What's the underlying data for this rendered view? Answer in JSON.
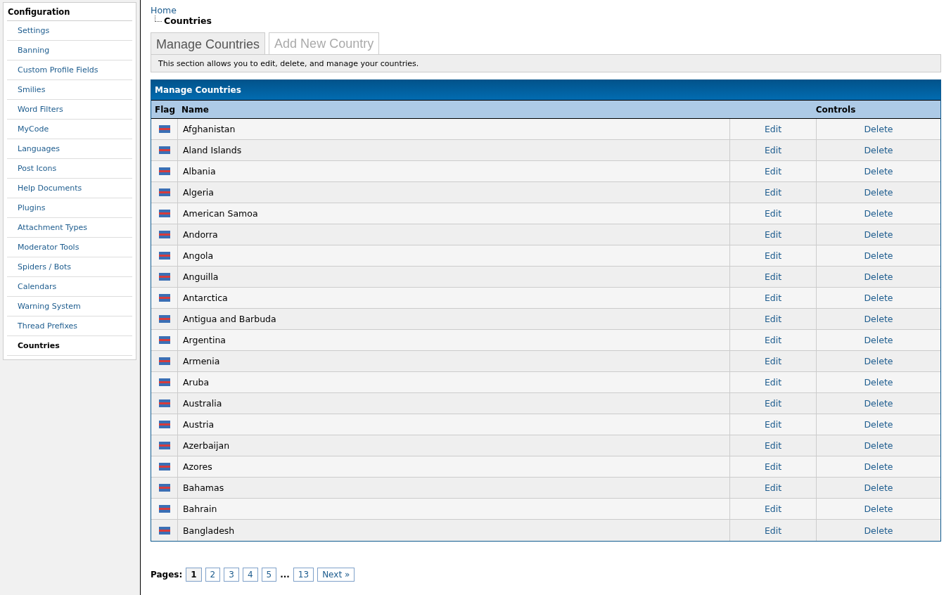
{
  "sidebar": {
    "title": "Configuration",
    "items": [
      {
        "label": "Settings",
        "selected": false
      },
      {
        "label": "Banning",
        "selected": false
      },
      {
        "label": "Custom Profile Fields",
        "selected": false
      },
      {
        "label": "Smilies",
        "selected": false
      },
      {
        "label": "Word Filters",
        "selected": false
      },
      {
        "label": "MyCode",
        "selected": false
      },
      {
        "label": "Languages",
        "selected": false
      },
      {
        "label": "Post Icons",
        "selected": false
      },
      {
        "label": "Help Documents",
        "selected": false
      },
      {
        "label": "Plugins",
        "selected": false
      },
      {
        "label": "Attachment Types",
        "selected": false
      },
      {
        "label": "Moderator Tools",
        "selected": false
      },
      {
        "label": "Spiders / Bots",
        "selected": false
      },
      {
        "label": "Calendars",
        "selected": false
      },
      {
        "label": "Warning System",
        "selected": false
      },
      {
        "label": "Thread Prefixes",
        "selected": false
      },
      {
        "label": "Countries",
        "selected": true
      }
    ]
  },
  "breadcrumb": {
    "home": "Home",
    "current": "Countries"
  },
  "tabs": [
    {
      "label": "Manage Countries",
      "selected": true
    },
    {
      "label": "Add New Country",
      "selected": false
    }
  ],
  "description": "This section allows you to edit, delete, and manage your countries.",
  "table": {
    "title": "Manage Countries",
    "columns": [
      "Flag",
      "Name",
      "Controls"
    ],
    "rows": [
      {
        "name": "Afghanistan",
        "edit": "Edit",
        "delete": "Delete"
      },
      {
        "name": "Aland Islands",
        "edit": "Edit",
        "delete": "Delete"
      },
      {
        "name": "Albania",
        "edit": "Edit",
        "delete": "Delete"
      },
      {
        "name": "Algeria",
        "edit": "Edit",
        "delete": "Delete"
      },
      {
        "name": "American Samoa",
        "edit": "Edit",
        "delete": "Delete"
      },
      {
        "name": "Andorra",
        "edit": "Edit",
        "delete": "Delete"
      },
      {
        "name": "Angola",
        "edit": "Edit",
        "delete": "Delete"
      },
      {
        "name": "Anguilla",
        "edit": "Edit",
        "delete": "Delete"
      },
      {
        "name": "Antarctica",
        "edit": "Edit",
        "delete": "Delete"
      },
      {
        "name": "Antigua and Barbuda",
        "edit": "Edit",
        "delete": "Delete"
      },
      {
        "name": "Argentina",
        "edit": "Edit",
        "delete": "Delete"
      },
      {
        "name": "Armenia",
        "edit": "Edit",
        "delete": "Delete"
      },
      {
        "name": "Aruba",
        "edit": "Edit",
        "delete": "Delete"
      },
      {
        "name": "Australia",
        "edit": "Edit",
        "delete": "Delete"
      },
      {
        "name": "Austria",
        "edit": "Edit",
        "delete": "Delete"
      },
      {
        "name": "Azerbaijan",
        "edit": "Edit",
        "delete": "Delete"
      },
      {
        "name": "Azores",
        "edit": "Edit",
        "delete": "Delete"
      },
      {
        "name": "Bahamas",
        "edit": "Edit",
        "delete": "Delete"
      },
      {
        "name": "Bahrain",
        "edit": "Edit",
        "delete": "Delete"
      },
      {
        "name": "Bangladesh",
        "edit": "Edit",
        "delete": "Delete"
      }
    ]
  },
  "pagination": {
    "label": "Pages:",
    "pages": [
      {
        "label": "1",
        "selected": true
      },
      {
        "label": "2",
        "selected": false
      },
      {
        "label": "3",
        "selected": false
      },
      {
        "label": "4",
        "selected": false
      },
      {
        "label": "5",
        "selected": false
      }
    ],
    "ellipsis": "...",
    "last": "13",
    "next": "Next »"
  }
}
